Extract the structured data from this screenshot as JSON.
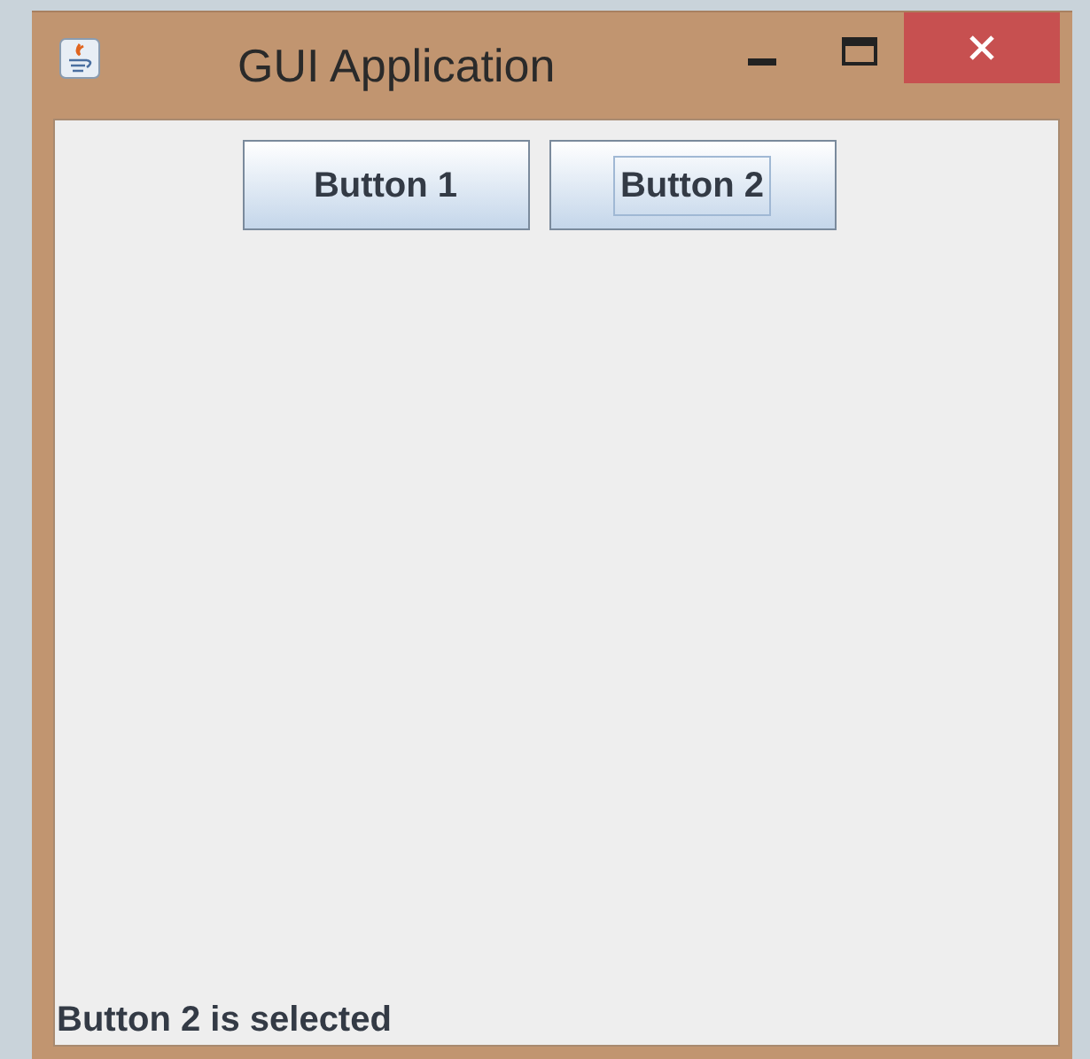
{
  "window": {
    "title": "GUI Application"
  },
  "buttons": [
    {
      "label": "Button 1",
      "focused": false
    },
    {
      "label": "Button 2",
      "focused": true
    }
  ],
  "status_label": "Button 2 is selected"
}
